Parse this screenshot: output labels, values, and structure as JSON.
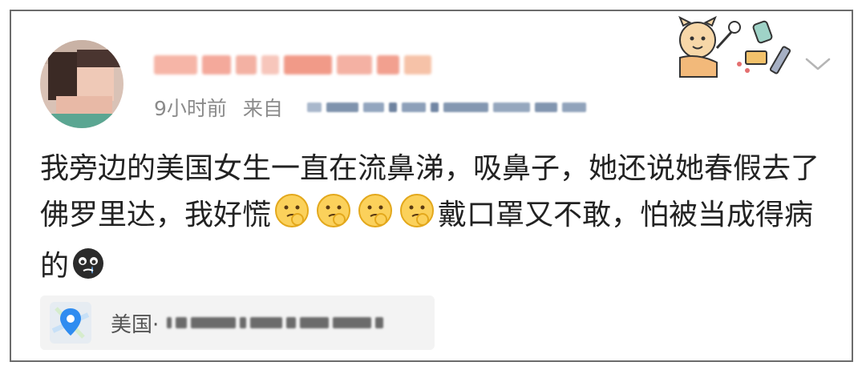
{
  "post": {
    "time_ago": "9小时前",
    "source_label": "来自",
    "content_part1": "我旁边的美国女生一直在流鼻涕，吸鼻子，她还说她春假去了佛罗里达，我好慌",
    "content_part2": "戴口罩又不敢，怕被当成得病的",
    "location_country": "美国·"
  },
  "icons": {
    "avatar": "user-avatar",
    "more": "chevron-down-icon",
    "sticker": "decorative-sticker",
    "emoji_worried": "thinking-face-emoji",
    "emoji_cry": "crying-face-emoji",
    "location": "map-pin-icon"
  },
  "colors": {
    "accent_location_pin": "#2f8cf0",
    "text_primary": "#222222",
    "text_meta": "#8b8b8b",
    "location_bg": "#f3f3f3"
  }
}
